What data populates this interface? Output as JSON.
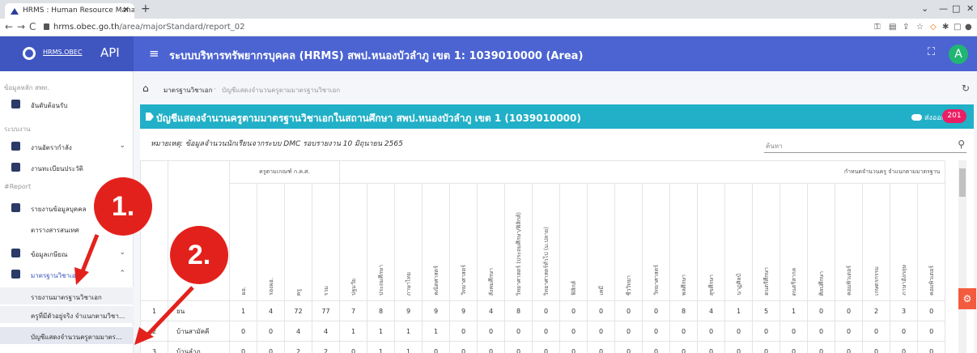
{
  "browser": {
    "tab_title": "HRMS : Human Resource Manag",
    "url_host": "hrms.obec.go.th",
    "url_path": "/area/majorStandard/report_02"
  },
  "header": {
    "brand_name": "HRMS.OBEC",
    "brand_suffix": "API",
    "title": "ระบบบริหารทรัพยากรบุคคล (HRMS) สพป.หนองบัวลำภู เขต 1: 1039010000 (Area)",
    "avatar_initial": "A",
    "accent_color": "#4c63d2"
  },
  "sidebar": {
    "section_main": "ข้อมูลหลัก สพท.",
    "section_work": "ระบบงาน",
    "section_report": "#Report",
    "items": [
      {
        "label": "อันดับต้อนรับ",
        "icon": "home-icon"
      },
      {
        "label": "งานอัตรากำลัง",
        "icon": "org-icon"
      },
      {
        "label": "งานทะเบียนประวัติ",
        "icon": "calendar-icon"
      },
      {
        "label": "รายงานข้อมูลบุคคล",
        "icon": "report-icon"
      },
      {
        "label": "ตารางสารสนเทศ",
        "icon": "table-icon"
      },
      {
        "label": "ข้อมูลเกษียณ",
        "icon": "retire-icon"
      },
      {
        "label": "มาตรฐานวิชาเอก",
        "icon": "monitor-icon"
      }
    ],
    "subitems": [
      "รายงานมาตรฐานวิชาเอก",
      "ครูที่มีตัวอยู่จริง จำแนกตามวิชา...",
      "บัญชีแสดงจำนวนครูตามมาตร..."
    ]
  },
  "breadcrumb": {
    "level1": "มาตรฐานวิชาเอก",
    "level2": "บัญชีแสดงจำนวนครูตามมาตรฐานวิชาเอก"
  },
  "card": {
    "title": "บัญชีแสดงจำนวนครูตามมาตรฐานวิชาเอกในสถานศึกษา สพป.หนองบัวลำภู เขต 1 (1039010000)",
    "export_label": "ส่งออก",
    "export_count": "201",
    "note": "หมายเหตุ: ข้อมูลจำนวนนักเรียนจากระบบ DMC รอบรายงาน 10 มิถุนายน 2565",
    "search_placeholder": "ค้นหา",
    "header_color": "#21b0c7"
  },
  "table": {
    "group1": "ครูตามเกณฑ์ ก.ค.ศ.",
    "group2": "กำหนดจำนวนครู จำแนกตามมาตรฐาน",
    "columns": [
      "ผอ.",
      "รองผอ.",
      "ครู",
      "รวม",
      "ปฐมวัย",
      "ประถมศึกษา",
      "ภาษาไทย",
      "คณิตศาสตร์",
      "วิทยาศาสตร์",
      "สังคมศึกษา",
      "วิทยาศาสตร์ (ประถมศึกษา/ฟิสิกส์)",
      "วิทยาศาสตร์ทั่วไป (ม.ปลาย)",
      "ฟิสิกส์",
      "เคมี",
      "ชีววิทยา",
      "วิทยาศาสตร์",
      "พลศึกษา",
      "สุขศึกษา",
      "นาฏศิลป์",
      "ดนตรีศึกษา",
      "ดนตรีสากล",
      "ศิลปศึกษา",
      "คอมพิวเตอร์",
      "เกษตรกรรม",
      "ภาษาอังกฤษ",
      "คอมพิวเตอร์"
    ],
    "rows": [
      {
        "no": "1",
        "name": "ยน",
        "vals": [
          "1",
          "4",
          "72",
          "77",
          "7",
          "8",
          "9",
          "9",
          "9",
          "4",
          "8",
          "0",
          "0",
          "0",
          "0",
          "0",
          "8",
          "4",
          "1",
          "5",
          "1",
          "0",
          "0",
          "2",
          "3",
          "0"
        ]
      },
      {
        "no": "2",
        "name": "บ้านสามัคคี",
        "vals": [
          "0",
          "0",
          "4",
          "4",
          "1",
          "1",
          "1",
          "1",
          "0",
          "0",
          "0",
          "0",
          "0",
          "0",
          "0",
          "0",
          "0",
          "0",
          "0",
          "0",
          "0",
          "0",
          "0",
          "0",
          "0",
          "0"
        ]
      },
      {
        "no": "3",
        "name": "บ้านลำภู",
        "vals": [
          "0",
          "0",
          "2",
          "2",
          "0",
          "1",
          "1",
          "0",
          "0",
          "0",
          "0",
          "0",
          "0",
          "0",
          "0",
          "0",
          "0",
          "0",
          "0",
          "0",
          "0",
          "0",
          "0",
          "0",
          "0",
          "0"
        ]
      }
    ]
  },
  "annotations": {
    "step1": "1.",
    "step2": "2.",
    "color": "#e3211c"
  }
}
